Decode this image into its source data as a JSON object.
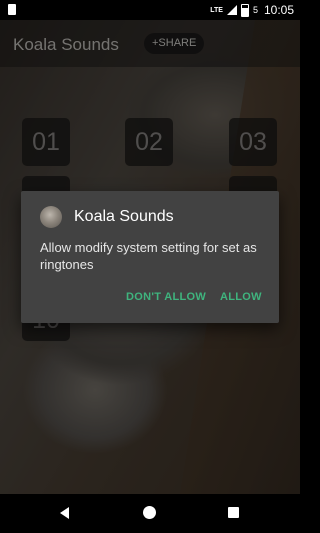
{
  "status_bar": {
    "network": "LTE",
    "battery": "5",
    "time": "10:05"
  },
  "app": {
    "title": "Koala Sounds",
    "share_label": "+SHARE",
    "tiles": [
      "01",
      "02",
      "03",
      "10"
    ]
  },
  "dialog": {
    "title": "Koala Sounds",
    "message": "Allow modify system setting for set as ringtones",
    "deny_label": "DON'T ALLOW",
    "allow_label": "ALLOW"
  },
  "colors": {
    "accent": "#3fb47e",
    "dialog_bg": "#424242"
  },
  "icons": {
    "sim": "sim-card-icon",
    "signal": "signal-icon",
    "battery": "battery-icon",
    "back": "back-icon",
    "home": "home-icon",
    "recents": "recents-icon"
  }
}
